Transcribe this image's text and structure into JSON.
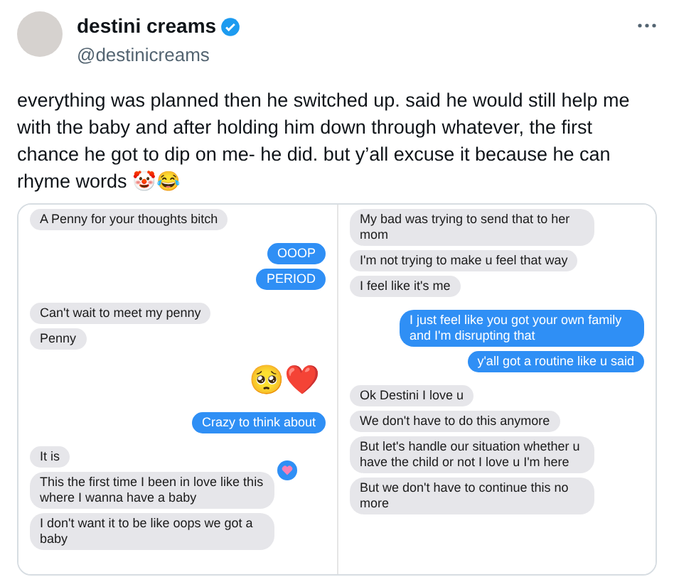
{
  "author": {
    "name": "destini creams",
    "verified": true,
    "handle": "@destinicreams"
  },
  "tweet_text": "everything was planned then he switched up. said he would still help me with the baby and after holding him down through whatever, the first chance he got to dip on me- he did. but y’all excuse it because he can rhyme words 🤡😂",
  "screenshots": [
    {
      "messages": [
        {
          "kind": "text",
          "sent": false,
          "text": "A Penny for your thoughts bitch"
        },
        {
          "kind": "text",
          "sent": true,
          "text": "OOOP"
        },
        {
          "kind": "text",
          "sent": true,
          "text": "PERIOD"
        },
        {
          "kind": "text",
          "sent": false,
          "text": "Can't wait to meet my penny"
        },
        {
          "kind": "text",
          "sent": false,
          "text": "Penny"
        },
        {
          "kind": "emoji",
          "text": "🥺❤️"
        },
        {
          "kind": "text",
          "sent": true,
          "text": "Crazy to think about"
        },
        {
          "kind": "text",
          "sent": false,
          "text": "It is"
        },
        {
          "kind": "text",
          "sent": false,
          "text": "This the first time I been in love like this where I wanna have a baby",
          "reaction": true
        },
        {
          "kind": "text",
          "sent": false,
          "text": "I don't want it to be like oops we got a baby"
        }
      ]
    },
    {
      "messages": [
        {
          "kind": "text",
          "sent": false,
          "text": "My bad was trying to send that to her mom"
        },
        {
          "kind": "text",
          "sent": false,
          "text": "I'm not trying to make u feel that way"
        },
        {
          "kind": "text",
          "sent": false,
          "text": "I feel like it's me"
        },
        {
          "kind": "text",
          "sent": true,
          "text": "I just feel like you got your own family and I'm disrupting that"
        },
        {
          "kind": "text",
          "sent": true,
          "text": "y'all got a routine like u said"
        },
        {
          "kind": "text",
          "sent": false,
          "text": "Ok Destini I love u"
        },
        {
          "kind": "text",
          "sent": false,
          "text": "We don't have to do this anymore"
        },
        {
          "kind": "text",
          "sent": false,
          "text": "But let's handle our situation whether u have the child or not I love u I'm here"
        },
        {
          "kind": "text",
          "sent": false,
          "text": "But we don't have to continue this no more"
        }
      ]
    }
  ]
}
